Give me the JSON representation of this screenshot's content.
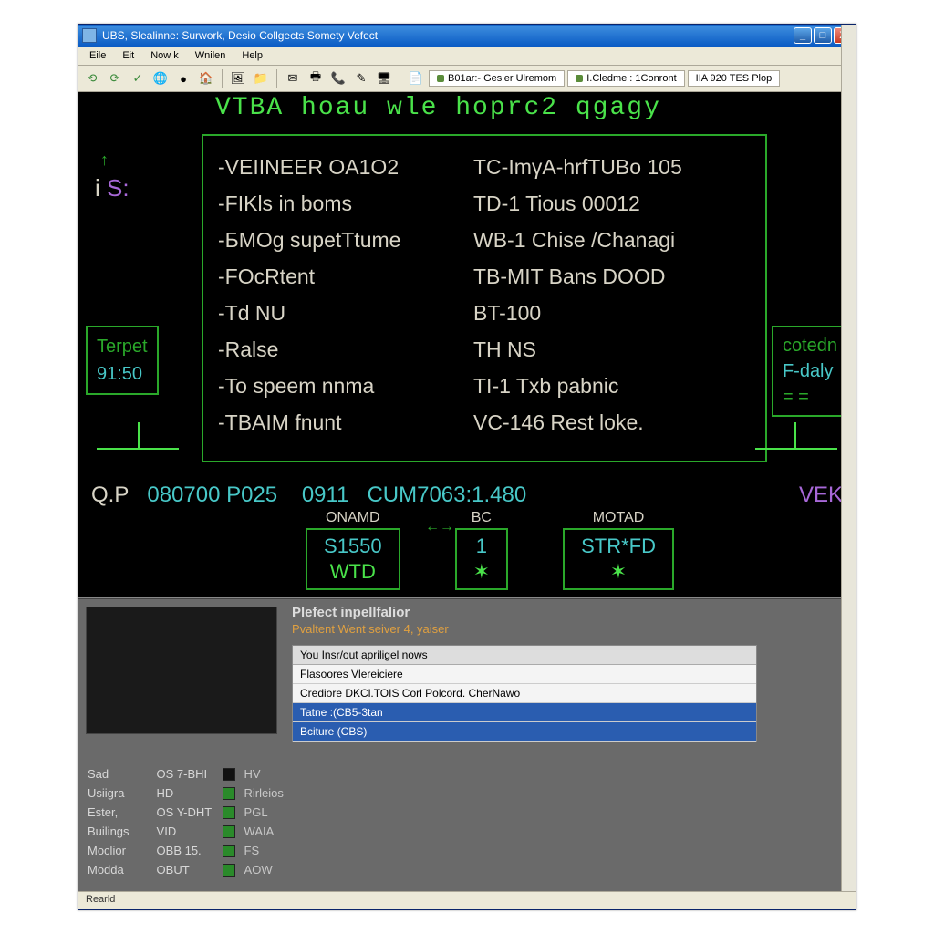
{
  "window": {
    "title": "UBS, Slealinne: Surwork, Desio Collgects Somety Vefect"
  },
  "menu": [
    "Eile",
    "Eit",
    "Now k",
    "Wnilen",
    "Help"
  ],
  "toolbar_tabs": [
    "B01ar:- Gesler Ulremom",
    "I.Cledme : 1Conront",
    "IIA 920 TES Plop"
  ],
  "terminal": {
    "header": "VTBA  hoau  wle  hoprc2  qgagy",
    "prompt": "S:",
    "menu_items": [
      {
        "l": "-VEIINEER OA1O2",
        "r": "TC-ImγA-hrfTUBo 105"
      },
      {
        "l": "-FIKls in boms",
        "r": "TD-1 Tious 00012"
      },
      {
        "l": "-БMOg supetTtume",
        "r": "WB-1 Chise /Chanagi"
      },
      {
        "l": "-FOcRtent",
        "r": "TB-MIT Bans DOOD"
      },
      {
        "l": "-Td NU",
        "r": "BT-100"
      },
      {
        "l": "-Ralse",
        "r": "TH NS"
      },
      {
        "l": "-To speem nnma",
        "r": "TI-1 Txb pabnic"
      },
      {
        "l": "-TBAIM fnunt",
        "r": "VC-146 Rest loke."
      }
    ],
    "left_box": {
      "a": "Terpet",
      "b": "91:50"
    },
    "right_box": {
      "a": "cotedn",
      "b": "F-daly",
      "c": "= ="
    },
    "status_line": {
      "qp": "Q.P",
      "qp_val": "080700 P025",
      "mid": " 0911",
      "cum": "CUM7063:1.480",
      "vek": "VEK"
    },
    "cards": [
      {
        "label": "ONAMD",
        "top": "S1550",
        "bot": "WTD"
      },
      {
        "label": "BC",
        "top": "1",
        "bot": "✶"
      },
      {
        "label": "MOTAD",
        "top": "STR*FD",
        "bot": "✶"
      }
    ]
  },
  "info_panel": {
    "title": "Plefect inpellfalior",
    "subtitle": "Pvaltent Went seiver 4, yaiser",
    "list_header": "You Insr/out apriligel nows",
    "list_rows": [
      {
        "text": "Flasoores Vlereiciere",
        "sel": false
      },
      {
        "text": "Crediore DKCl.TOIS Corl Polcord. CherNawo",
        "sel": false
      },
      {
        "text": "Tatne :(CB5-3tan",
        "sel": true
      },
      {
        "text": "Bciture (CBS)",
        "sel": true
      }
    ]
  },
  "labels_col": [
    "Sad",
    "Usiigra",
    "Ester,",
    "Builings",
    "Moclior",
    "Modda"
  ],
  "status_col": [
    {
      "k": "OS 7-BHI",
      "v": "HV",
      "ind": "off"
    },
    {
      "k": "HD",
      "v": "Rirleios",
      "ind": "on"
    },
    {
      "k": "OS Y-DHT",
      "v": "PGL",
      "ind": "on"
    },
    {
      "k": "VID",
      "v": "WAIA",
      "ind": "on"
    },
    {
      "k": "OBB 15.",
      "v": "FS",
      "ind": "on"
    },
    {
      "k": "OBUT",
      "v": "AOW",
      "ind": "on"
    }
  ],
  "statusbar": "Rearld"
}
